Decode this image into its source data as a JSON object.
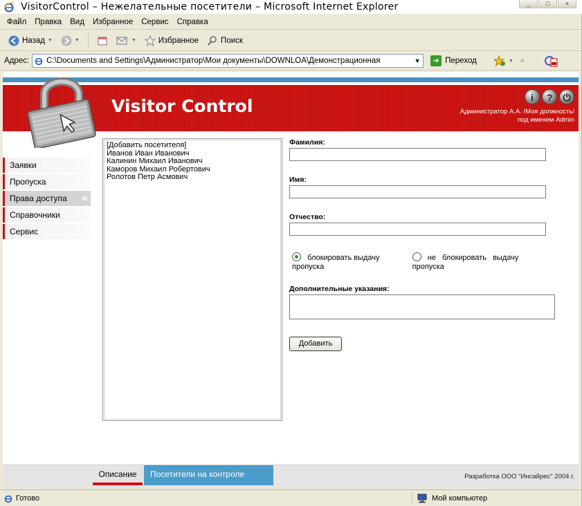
{
  "window": {
    "title": "VisitorControl – Нежелательные посетители – Microsoft Internet Explorer",
    "controls": [
      "_",
      "□",
      "×"
    ]
  },
  "menu": [
    "Файл",
    "Правка",
    "Вид",
    "Избранное",
    "Сервис",
    "Справка"
  ],
  "toolbar": {
    "back": "Назад",
    "favorites": "Избранное",
    "search": "Поиск"
  },
  "address": {
    "label": "Адрес:",
    "value": "C:\\Documents and Settings\\Администратор\\Мои документы\\DOWNLOA\\Демонстрационная",
    "go": "Переход"
  },
  "banner": {
    "title": "Visitor Control",
    "user_line1": "Администратор А.А. /Моя должность/",
    "user_line2": "под именем Admin",
    "icons": [
      "info-icon",
      "help-icon",
      "power-icon"
    ]
  },
  "nav": [
    {
      "label": "Заявки",
      "active": false
    },
    {
      "label": "Пропуска",
      "active": false
    },
    {
      "label": "Права доступа",
      "active": true
    },
    {
      "label": "Справочники",
      "active": false
    },
    {
      "label": "Сервис",
      "active": false
    }
  ],
  "visitors": [
    "[Добавить посетителя]",
    "Иванов Иван Иванович",
    "Калинин Михаил Иванович",
    "Каморов Михаил Робертович",
    "Ролотов Петр Асмович"
  ],
  "form": {
    "surname_label": "Фамилия:",
    "name_label": "Имя:",
    "patronymic_label": "Отчество:",
    "radio_block": "блокировать выдачу пропуска",
    "radio_noblock": "не блокировать выдачу пропуска",
    "notes_label": "Дополнительные указания:",
    "submit": "Добавить"
  },
  "footer": {
    "tab_description": "Описание",
    "tab_controlled": "Посетители на контроле",
    "copyright": "Разработка ООО \"Инсайрес\" 2004 г."
  },
  "status": {
    "left": "Готово",
    "right": "Мой компьютер"
  },
  "colors": {
    "banner_red": "#c8100e",
    "accent_blue": "#4b9cc9"
  }
}
